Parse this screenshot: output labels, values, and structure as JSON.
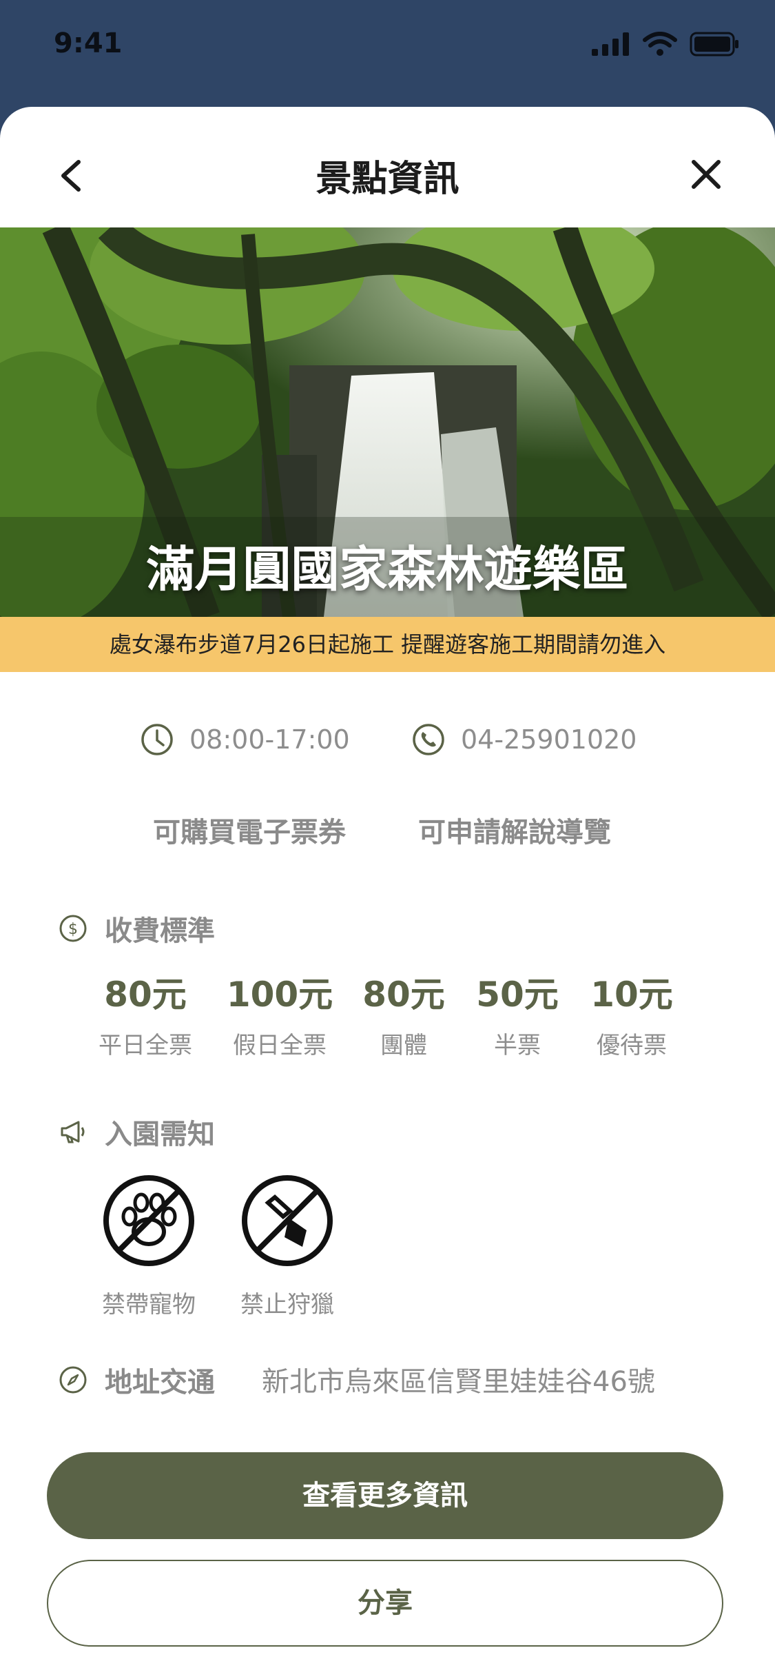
{
  "status_bar": {
    "time": "9:41"
  },
  "nav": {
    "title": "景點資訊",
    "back_icon": "chevron-left-icon",
    "close_icon": "close-icon"
  },
  "hero": {
    "title": "滿月圓國家森林遊樂區"
  },
  "notice": {
    "text": "處女瀑布步道7月26日起施工 提醒遊客施工期間請勿進入"
  },
  "info": {
    "hours": "08:00-17:00",
    "phone": "04-25901020"
  },
  "features": [
    "可購買電子票券",
    "可申請解說導覽"
  ],
  "fees": {
    "title": "收費標準",
    "items": [
      {
        "price": "80元",
        "label": "平日全票"
      },
      {
        "price": "100元",
        "label": "假日全票"
      },
      {
        "price": "80元",
        "label": "團體"
      },
      {
        "price": "50元",
        "label": "半票"
      },
      {
        "price": "10元",
        "label": "優待票"
      }
    ]
  },
  "rules": {
    "title": "入園需知",
    "items": [
      {
        "label": "禁帶寵物",
        "icon": "no-pets-icon"
      },
      {
        "label": "禁止狩獵",
        "icon": "no-hunting-icon"
      }
    ]
  },
  "address": {
    "label": "地址交通",
    "value": "新北市烏來區信賢里娃娃谷46號"
  },
  "buttons": {
    "more_info": "查看更多資訊",
    "share": "分享"
  },
  "colors": {
    "accent": "#5a6347",
    "notice_bg": "#f6c66b",
    "header_bg": "#2f4566",
    "text_gray": "#8d8d8d"
  }
}
